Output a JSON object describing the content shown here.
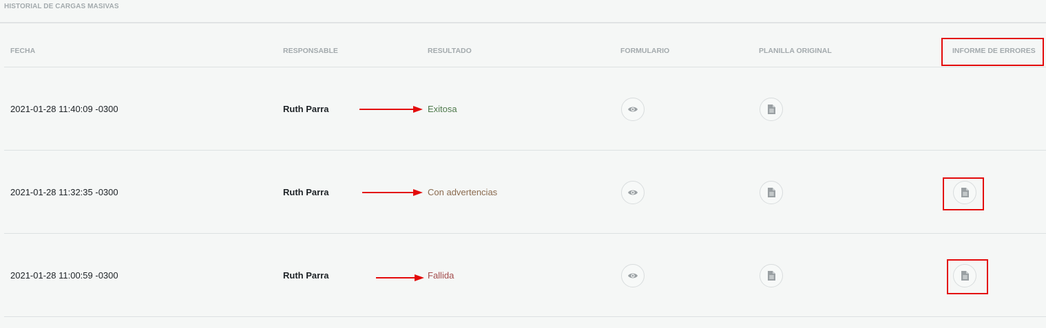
{
  "section_title": "HISTORIAL DE CARGAS MASIVAS",
  "columns": {
    "fecha": "FECHA",
    "responsable": "RESPONSABLE",
    "resultado": "RESULTADO",
    "formulario": "FORMULARIO",
    "planilla_original": "PLANILLA ORIGINAL",
    "informe_errores": "INFORME DE ERRORES"
  },
  "rows": [
    {
      "fecha": "2021-01-28 11:40:09 -0300",
      "responsable": "Ruth Parra",
      "resultado": "Exitosa",
      "resultado_status": "success",
      "has_error_report": false
    },
    {
      "fecha": "2021-01-28 11:32:35 -0300",
      "responsable": "Ruth Parra",
      "resultado": "Con advertencias",
      "resultado_status": "warning",
      "has_error_report": true
    },
    {
      "fecha": "2021-01-28 11:00:59 -0300",
      "responsable": "Ruth Parra",
      "resultado": "Fallida",
      "resultado_status": "failed",
      "has_error_report": true
    }
  ],
  "icons": {
    "formulario": "eye-icon",
    "planilla": "document-icon",
    "informe": "document-icon"
  },
  "colors": {
    "background": "#f5f7f6",
    "header_text": "#a3aaad",
    "success": "#4f7a4c",
    "warning": "#8a6a4e",
    "failed": "#a24a4a",
    "annotation_red": "#e30a0a"
  }
}
